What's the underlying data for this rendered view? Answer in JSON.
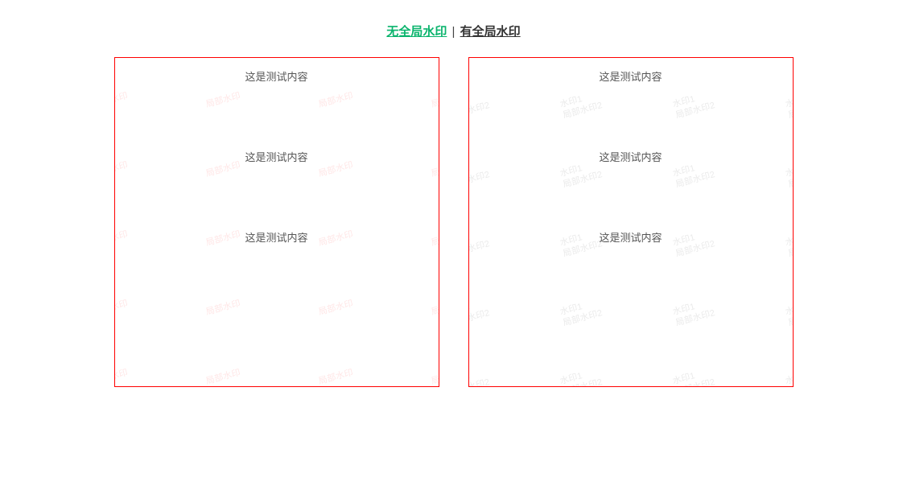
{
  "header": {
    "link_no_global": "无全局水印",
    "separator": "|",
    "link_has_global": "有全局水印"
  },
  "content_text": "这是测试内容",
  "panel_left": {
    "watermark": {
      "style": "red",
      "line1": "局部水印",
      "line2": ""
    },
    "rows": 3
  },
  "panel_right": {
    "watermark": {
      "style": "gray",
      "line1": "水印1",
      "line2": "局部水印2"
    },
    "rows": 3
  },
  "grid": {
    "cols": [
      -20,
      120,
      260,
      400
    ],
    "rows": [
      32,
      118,
      204,
      290,
      376
    ]
  }
}
